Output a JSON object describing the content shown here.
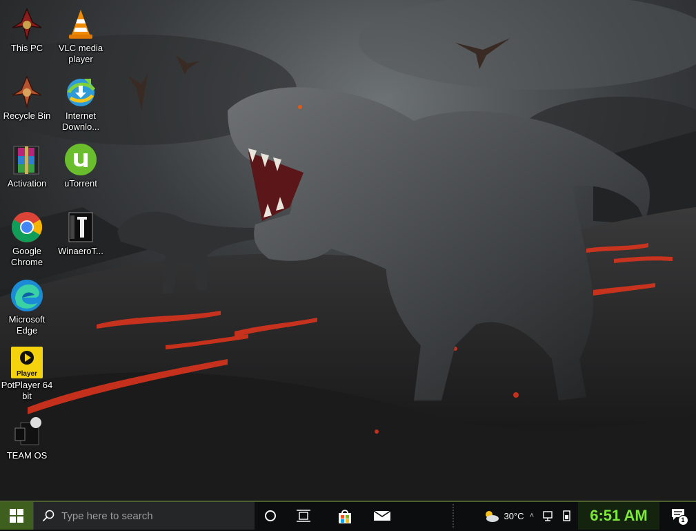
{
  "desktop": {
    "icons": [
      {
        "label": "This PC",
        "icon": "klingon-emblem-icon"
      },
      {
        "label": "VLC media player",
        "icon": "vlc-cone-icon"
      },
      {
        "label": "Recycle Bin",
        "icon": "klingon-emblem-icon"
      },
      {
        "label": "Internet Downlo...",
        "icon": "internet-download-manager-icon"
      },
      {
        "label": "Activation",
        "icon": "winrar-icon"
      },
      {
        "label": "uTorrent",
        "icon": "utorrent-icon"
      },
      {
        "label": "Google Chrome",
        "icon": "chrome-icon"
      },
      {
        "label": "WinaeroT...",
        "icon": "winaero-tweaker-icon"
      },
      {
        "label": "Microsoft Edge",
        "icon": "edge-icon"
      },
      {
        "label": "PotPlayer 64 bit",
        "icon": "potplayer-icon",
        "badge": "Player"
      },
      {
        "label": "TEAM OS",
        "icon": "team-os-icon"
      }
    ]
  },
  "taskbar": {
    "search_placeholder": "Type here to search",
    "weather_temp": "30°C",
    "clock_time": "6:51 AM",
    "notification_count": "1",
    "accent_color": "#3f5f1f",
    "clock_color": "#7ee83a"
  }
}
